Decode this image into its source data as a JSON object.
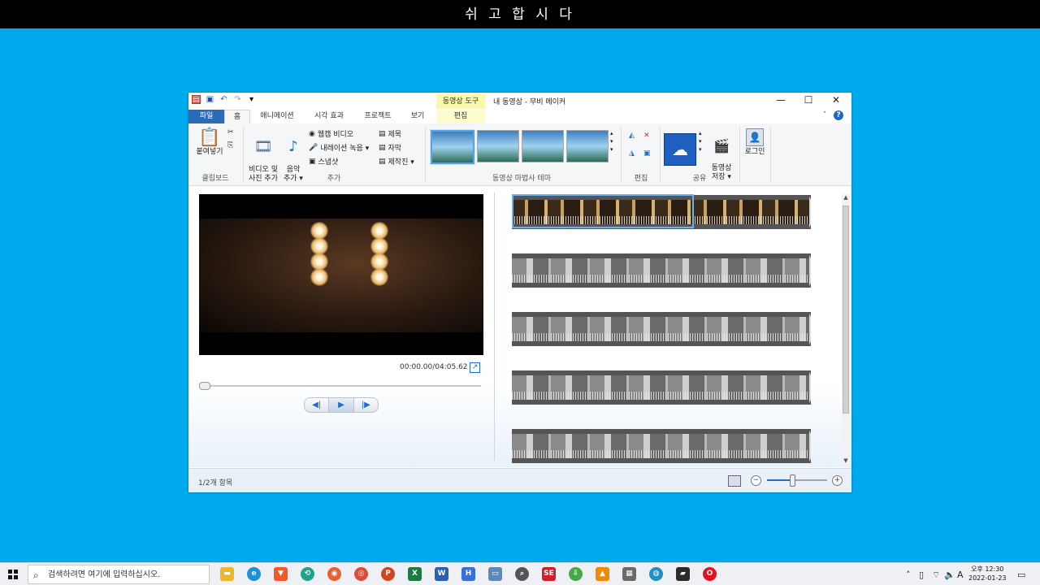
{
  "screen_title": "쉬 고 합 시 다",
  "window": {
    "title": "내 동영상 - 무비 메이커",
    "context_tab_group": "동영상 도구",
    "controls": {
      "minimize": "—",
      "maximize": "☐",
      "close": "✕"
    }
  },
  "tabs": [
    "파일",
    "홈",
    "애니메이션",
    "시각 효과",
    "프로젝트",
    "보기",
    "편집"
  ],
  "ribbon": {
    "clipboard": {
      "paste": "붙여넣기",
      "label": "클립보드"
    },
    "add": {
      "video_photo": "비디오 및\n사진 추가",
      "music": "음악\n추가 ▾",
      "webcam": "웹캠 비디오",
      "narration": "내레이션 녹음 ▾",
      "snapshot": "스냅샷",
      "title": "제목",
      "caption": "자막",
      "credits": "제작진 ▾",
      "label": "추가"
    },
    "themes": {
      "label": "동영상 마법사 테마"
    },
    "edit": {
      "label": "편집"
    },
    "share": {
      "label": "공유",
      "save_movie": "동영상\n저장 ▾"
    },
    "signin": "로그인"
  },
  "player": {
    "timecode": "00:00.00/04:05.62",
    "progress": 0
  },
  "status": {
    "items": "1/2개 항목",
    "zoom": "+",
    "zoom_out": "−",
    "zoom_level": 0.4
  },
  "taskbar": {
    "search_placeholder": "검색하려면 여기에 입력하십시오.",
    "time": "오후 12:30",
    "date": "2022-01-23",
    "ime": "A"
  }
}
